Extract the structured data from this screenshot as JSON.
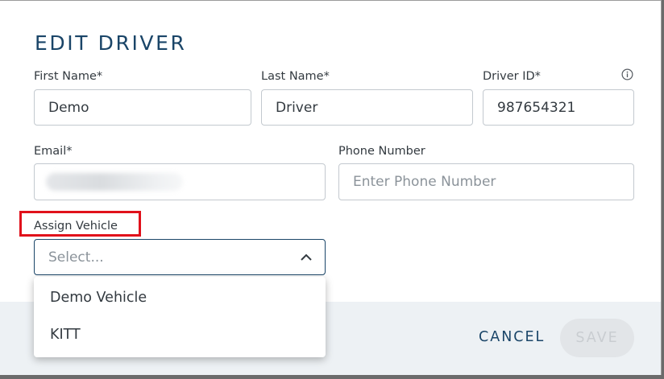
{
  "dialog": {
    "title": "EDIT DRIVER",
    "first_name": {
      "label": "First Name*",
      "value": "Demo"
    },
    "last_name": {
      "label": "Last Name*",
      "value": "Driver"
    },
    "driver_id": {
      "label": "Driver ID*",
      "value": "987654321"
    },
    "email": {
      "label": "Email*"
    },
    "phone": {
      "label": "Phone Number",
      "placeholder": "Enter Phone Number"
    },
    "assign_vehicle": {
      "label": "Assign Vehicle",
      "placeholder": "Select...",
      "options": [
        "Demo Vehicle",
        "KITT"
      ]
    },
    "cancel_label": "CANCEL",
    "save_label": "SAVE"
  },
  "colors": {
    "accent": "#1a4568",
    "highlight": "#e0111b",
    "footer_bg": "#edf1f4"
  }
}
